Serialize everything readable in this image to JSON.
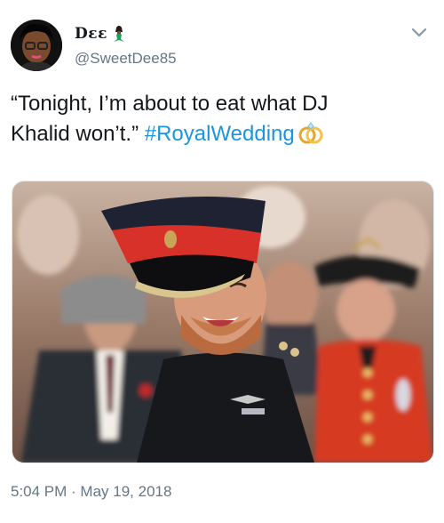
{
  "author": {
    "display_name": "Dεε",
    "handle": "@SweetDee85",
    "avatar_icon": "profile-photo",
    "name_emoji": "mermaid-emoji"
  },
  "tweet": {
    "text_line1": "“Tonight, I’m about to eat what DJ",
    "text_line2": "Khalid won’t.” ",
    "hashtag": "#RoyalWedding",
    "trailing_emoji": "rings-emoji"
  },
  "media": {
    "type": "photo",
    "description_icon": "photo-of-smiling-soldier-in-uniform"
  },
  "meta": {
    "timestamp": "5:04 PM · May 19, 2018"
  },
  "colors": {
    "text": "#14171a",
    "secondary": "#657786",
    "link": "#1b95e0"
  }
}
